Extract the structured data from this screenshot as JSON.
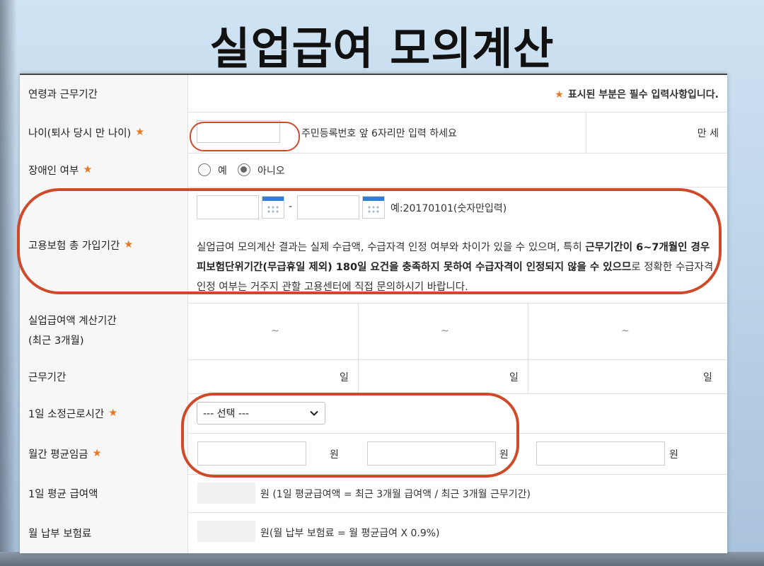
{
  "slide_title": "실업급여 모의계산",
  "header_row": {
    "label": "연령과 근무기간",
    "required_note_star": "★",
    "required_note": "표시된 부분은 필수 입력사항입니다."
  },
  "age_row": {
    "label": "나이(퇴사 당시 만 나이)",
    "required": "★",
    "input_value": "",
    "hint": "주민등록번호 앞 6자리만 입력 하세요",
    "result_label": "만 세"
  },
  "disability_row": {
    "label": "장애인 여부",
    "required": "★",
    "options": [
      "예",
      "아니오"
    ],
    "selected": "아니오"
  },
  "insurance_period_row": {
    "label": "고용보험 총 가입기간",
    "required": "★",
    "start_value": "",
    "end_value": "",
    "separator": "-",
    "example": "예:20170101(숫자만입력)",
    "notice_plain_1": "실업급여 모의계산 결과는 실제 수급액, 수급자격 인정 여부와 차이가 있을 수 있으며, 특히 ",
    "notice_bold": "근무기간이 6~7개월인 경우 피보험단위기간(무급휴일 제외) 180일 요건을 충족하지 못하여 수급자격이 인정되지 않을 수 있으므",
    "notice_plain_2": "로 정확한 수급자격 인정 여부는 거주지 관할 고용센터에 직접 문의하시기 바랍니다."
  },
  "calc_period_row": {
    "label_line1": "실업급여액 계산기간",
    "label_line2": "(최근 3개월)",
    "columns": [
      "~",
      "~",
      "~"
    ]
  },
  "work_period_row": {
    "label": "근무기간",
    "unit": "일",
    "columns": [
      "",
      "",
      ""
    ]
  },
  "hours_row": {
    "label": "1일 소정근로시간",
    "required": "★",
    "select_value": "--- 선택 ---"
  },
  "wage_row": {
    "label": "월간 평균임금",
    "required": "★",
    "unit": "원",
    "values": [
      "",
      "",
      ""
    ]
  },
  "daily_avg_row": {
    "label": "1일 평균 급여액",
    "note": "원 (1일 평균급여액 = 최근 3개월 급여액 / 최근 3개월 근무기간)"
  },
  "premium_row": {
    "label": "월 납부 보험료",
    "note": "원(월 납부 보험료 = 월 평균급여 X 0.9%)"
  },
  "colors": {
    "accent_star": "#e8791f",
    "highlight_circle": "#cf4a2a",
    "calendar_blue": "#2f7fd4"
  }
}
